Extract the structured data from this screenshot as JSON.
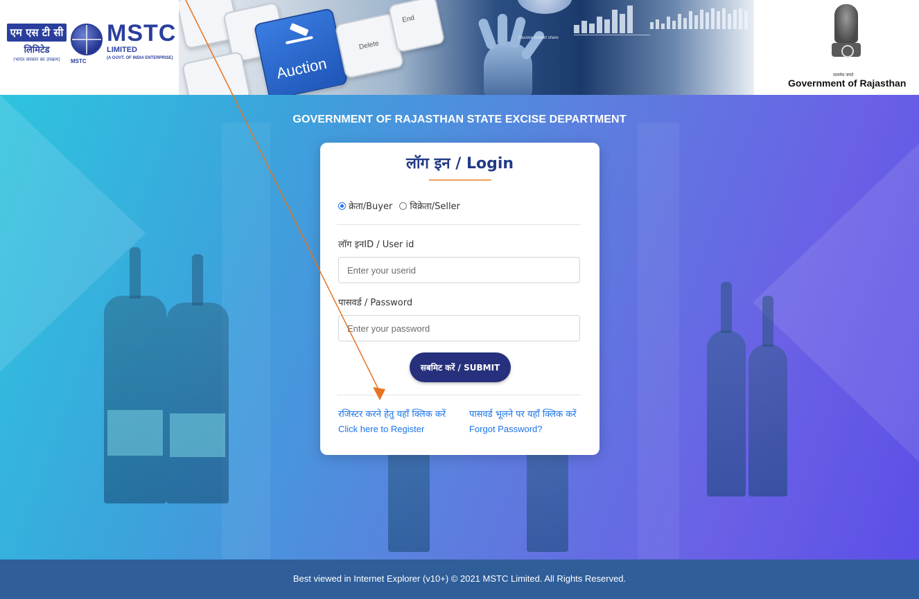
{
  "header": {
    "mstc_hindi_top": "एम एस टी सी",
    "mstc_hindi_mid": "लिमिटेड",
    "mstc_hindi_bottom": "(भारत सरकार का उपक्रम)",
    "mstc_small_tag": "MSTC",
    "mstc_en_big": "MSTC",
    "mstc_en_limited": "LIMITED",
    "mstc_en_tag": "(A GOVT. OF INDIA ENTERPRISE)",
    "banner_auction_label": "Auction",
    "banner_key_delete": "Delete",
    "banner_key_end": "End",
    "banner_chart_caption": "Passive market share",
    "emblem_caption": "सत्यमेव जयते",
    "government_title": "Government of Rajasthan"
  },
  "main": {
    "department_title": "GOVERNMENT OF RAJASTHAN STATE EXCISE DEPARTMENT"
  },
  "login": {
    "title": "लॉग इन / Login",
    "roles": [
      {
        "label": "क्रेता/Buyer",
        "selected": true
      },
      {
        "label": "विक्रेता/Seller",
        "selected": false
      }
    ],
    "userid_label": "लॉग इनID / User id",
    "userid_placeholder": "Enter your userid",
    "userid_value": "",
    "password_label": "पासवर्ड / Password",
    "password_placeholder": "Enter your password",
    "password_value": "",
    "submit_label": "सबमिट करें / SUBMIT",
    "register_hindi": "रजिस्टर करने हेतु यहाँ क्लिक करें",
    "register_en": "Click here to Register",
    "forgot_hindi": "पासवर्ड भूलने पर यहाँ क्लिक करें",
    "forgot_en": "Forgot Password?"
  },
  "footer": {
    "text": "Best viewed in Internet Explorer (v10+) © 2021 MSTC Limited. All Rights Reserved."
  },
  "colors": {
    "brand_navy": "#26307c",
    "link_blue": "#1a73e8",
    "footer_blue": "#2f5e99",
    "accent_orange": "#f0a25b",
    "annotation_arrow": "#e8731f"
  }
}
